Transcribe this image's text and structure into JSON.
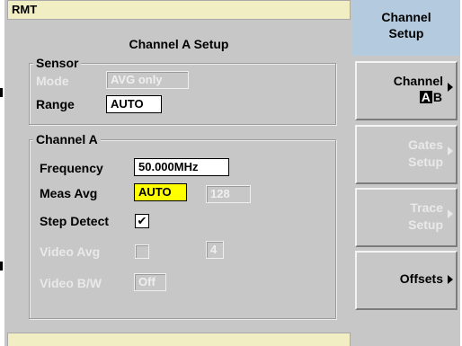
{
  "status": {
    "text": "RMT"
  },
  "panel": {
    "title": "Channel A Setup"
  },
  "sensor": {
    "group_label": "Sensor",
    "mode_label": "Mode",
    "mode_value": "AVG only",
    "range_label": "Range",
    "range_value": "AUTO"
  },
  "channel": {
    "group_label": "Channel A",
    "frequency_label": "Frequency",
    "frequency_value": "50.000MHz",
    "meas_avg_label": "Meas Avg",
    "meas_avg_value": "AUTO",
    "meas_avg_count": "128",
    "step_detect_label": "Step Detect",
    "step_detect_checked": "✔",
    "video_avg_label": "Video Avg",
    "video_avg_value": "4",
    "video_bw_label": "Video B/W",
    "video_bw_value": "Off"
  },
  "softkeys": {
    "header_line1": "Channel",
    "header_line2": "Setup",
    "channel_label": "Channel",
    "channel_a": "A",
    "channel_b": "B",
    "gates_line1": "Gates",
    "gates_line2": "Setup",
    "trace_line1": "Trace",
    "trace_line2": "Setup",
    "offsets_label": "Offsets"
  }
}
